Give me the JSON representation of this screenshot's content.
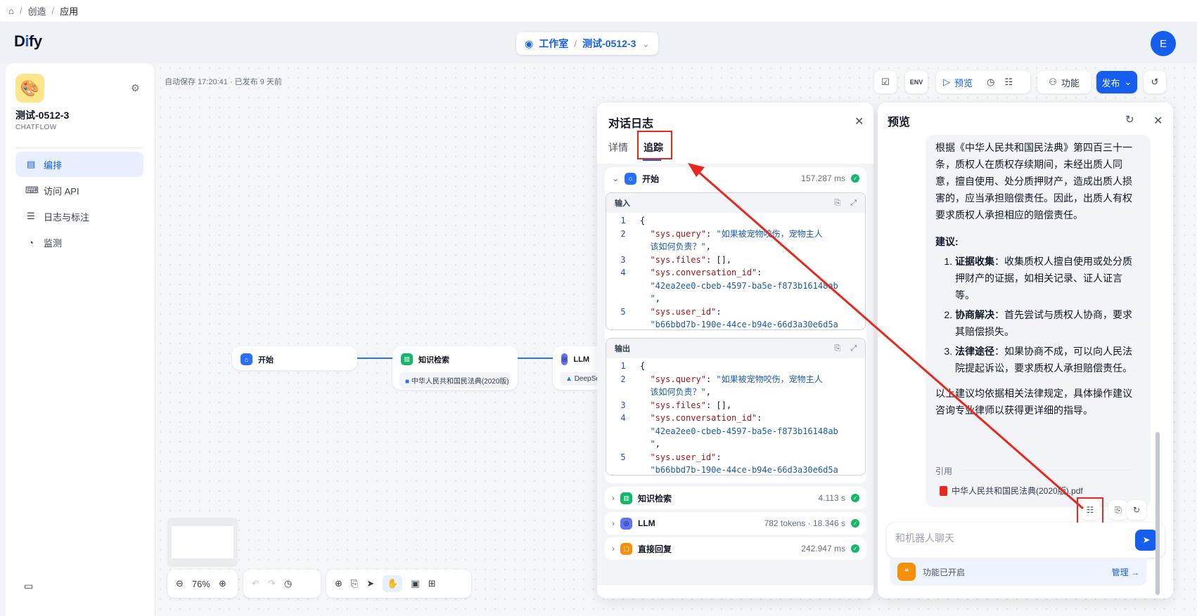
{
  "breadcrumb": {
    "items": [
      "创造",
      "应用"
    ],
    "sep": "/"
  },
  "header": {
    "logo_pre": "D",
    "logo_i": "i",
    "logo_post": "fy",
    "workspace": "工作室",
    "app_selector": "测试-0512-3",
    "avatar_initial": "E"
  },
  "sidebar": {
    "app_name": "测试-0512-3",
    "app_type": "CHATFLOW",
    "items": [
      {
        "label": "编排",
        "icon": "layout-icon",
        "glyph": "▤",
        "active": true
      },
      {
        "label": "访问 API",
        "icon": "terminal-icon",
        "glyph": "⌨",
        "active": false
      },
      {
        "label": "日志与标注",
        "icon": "document-icon",
        "glyph": "☰",
        "active": false
      },
      {
        "label": "监测",
        "icon": "gauge-icon",
        "glyph": "◔",
        "active": false
      }
    ]
  },
  "canvas": {
    "autosave": "自动保存 17:20:41 · 已发布 9 天前",
    "toolbar": {
      "env": "ENV",
      "preview": "预览",
      "features": "功能",
      "publish": "发布"
    },
    "nodes": {
      "start": "开始",
      "knowledge": "知识检索",
      "knowledge_dataset": "中华人民共和国民法典(2020版)",
      "llm": "LLM",
      "llm_model": "DeepSe"
    },
    "zoom": "76%"
  },
  "log": {
    "title": "对话日志",
    "tabs": [
      "详情",
      "追踪"
    ],
    "start": {
      "name": "开始",
      "time": "157.287 ms"
    },
    "input_label": "输入",
    "output_label": "输出",
    "code_lines": [
      {
        "n": "1",
        "t": "{"
      },
      {
        "n": "2",
        "k": "\"sys.query\"",
        "v": "\"如果被宠物咬伤，宠物主人"
      },
      {
        "n": "",
        "v": "该如何负责？\"",
        "tail": ","
      },
      {
        "n": "3",
        "k": "\"sys.files\"",
        "p": "[],"
      },
      {
        "n": "4",
        "k": "\"sys.conversation_id\"",
        "p": ":"
      },
      {
        "n": "",
        "v": "\"42ea2ee0-cbeb-4597-ba5e-f873b16148ab"
      },
      {
        "n": "",
        "v": "\"",
        "tail": ","
      },
      {
        "n": "5",
        "k": "\"sys.user_id\"",
        "p": ":"
      },
      {
        "n": "",
        "v": "\"b66bbd7b-190e-44ce-b94e-66d3a30e6d5a"
      }
    ],
    "nodes": [
      {
        "name": "知识检索",
        "meta": "4.113 s",
        "icon": "book-icon",
        "color": "g"
      },
      {
        "name": "LLM",
        "meta": "782 tokens · 18.346 s",
        "icon": "llm-icon",
        "color": "p"
      },
      {
        "name": "直接回复",
        "meta": "242.947 ms",
        "icon": "reply-icon",
        "color": "o"
      }
    ]
  },
  "preview": {
    "title": "预览",
    "para1": "根据《中华人民共和国民法典》第四百三十一条，质权人在质权存续期间，未经出质人同意，擅自使用、处分质押财产，造成出质人损害的，应当承担赔偿责任。因此，出质人有权要求质权人承担相应的赔偿责任。",
    "advice_label": "建议:",
    "advice": [
      {
        "b": "证据收集",
        "t": "：收集质权人擅自使用或处分质押财产的证据，如相关记录、证人证言等。"
      },
      {
        "b": "协商解决",
        "t": "：首先尝试与质权人协商，要求其赔偿损失。"
      },
      {
        "b": "法律途径",
        "t": "：如果协商不成，可以向人民法院提起诉讼，要求质权人承担赔偿责任。"
      }
    ],
    "closing": "以上建议均依据相关法律规定，具体操作建议咨询专业律师以获得更详细的指导。",
    "cite_label": "引用",
    "cite_file": "中华人民共和国民法典(2020版).pdf",
    "input_placeholder": "和机器人聊天",
    "features_on": "功能已开启",
    "manage": "管理 →"
  },
  "colors": {
    "accent": "#155eef",
    "highlight": "#e8281e",
    "success": "#12b76a"
  }
}
